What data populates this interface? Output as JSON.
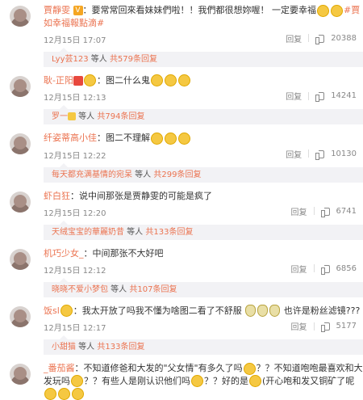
{
  "comments": [
    {
      "user": "賈靜雯",
      "badge": "V",
      "text": "：要常常回來看妹妹們啦！！我們都很想妳喔！ 一定要幸福",
      "hashtag": "#賈如幸福報點滴#",
      "time": "12月15日 17:07",
      "reply": "回复",
      "likes": "20388",
      "thread": {
        "user": "Lyy芸123",
        "mid": " 等人 ",
        "count": "共579条回复"
      }
    },
    {
      "user": "耿-正阳",
      "text": "：图二什么鬼",
      "time": "12月15日 12:13",
      "reply": "回复",
      "likes": "14241",
      "thread": {
        "user": "罗一",
        "mid": " 等人 ",
        "count": "共794条回复"
      }
    },
    {
      "user": "纤姿蒂高小佳",
      "text": "：图二不理解",
      "time": "12月15日 12:22",
      "reply": "回复",
      "likes": "10130",
      "thread": {
        "user": "每天都充满基情的宛呆",
        "mid": " 等人 ",
        "count": "共299条回复"
      }
    },
    {
      "user": "虾白狂",
      "text": "：说中间那张是贾静雯的可能是疯了",
      "time": "12月15日 12:20",
      "reply": "回复",
      "likes": "6741",
      "thread": {
        "user": "天绒宝宝的華麗奶昔",
        "mid": " 等人 ",
        "count": "共133条回复"
      }
    },
    {
      "user": "机巧少女_",
      "text": "：中间那张不大好吧",
      "time": "12月15日 12:12",
      "reply": "回复",
      "likes": "6856",
      "thread": {
        "user": "晓晓不爱小梦包",
        "mid": " 等人 ",
        "count": "共107条回复"
      }
    },
    {
      "user": "饭sl",
      "text": "：我太开放了吗我不懂为啥图二看了不舒服",
      "text2": "也许是粉丝滤镜???",
      "time": "12月15日 12:17",
      "reply": "回复",
      "likes": "5177",
      "thread": {
        "user": "小甜猫",
        "mid": " 等人 ",
        "count": "共133条回复"
      }
    },
    {
      "user": "_番茄酱",
      "text": "：不知道修爸和大发的\"父女情\"有多久了吗",
      "text2": "？？不知道咆咆最喜欢和大发玩吗",
      "text3": "？？有些人是刚认识他们吗",
      "text4": "？？好的是",
      "text5": "(开心咆和发又铜矿了呢"
    }
  ]
}
